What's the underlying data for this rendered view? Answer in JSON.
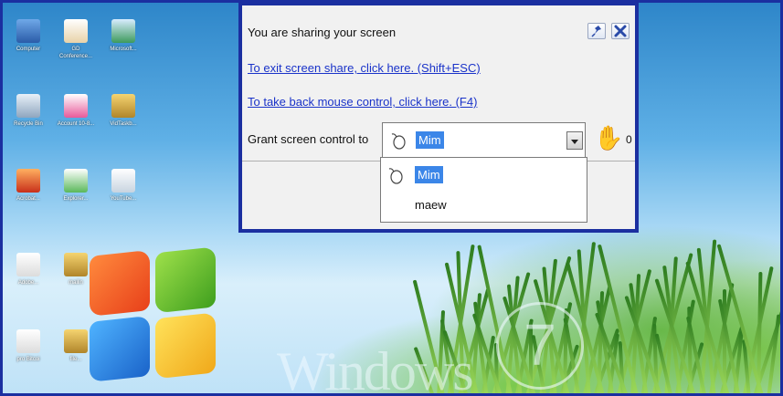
{
  "desktop": {
    "icons": [
      {
        "label": "Computer"
      },
      {
        "label": "GD Conference..."
      },
      {
        "label": "Microsoft..."
      },
      {
        "label": "Recycle Bin"
      },
      {
        "label": "Account 10-8..."
      },
      {
        "label": "VidTaskb..."
      },
      {
        "label": "Acrobat..."
      },
      {
        "label": "Explorer..."
      },
      {
        "label": "YouTube..."
      },
      {
        "label": "Adobe..."
      },
      {
        "label": "mailin"
      },
      {
        "label": "pro Bitcoi"
      },
      {
        "label": "file..."
      }
    ],
    "wallpaper_text": "Windows",
    "wallpaper_number": "7"
  },
  "share_panel": {
    "status": "You are sharing your screen",
    "exit_link": "To exit screen share, click here. (Shift+ESC)",
    "mouse_link": "To take back mouse control, click here. (F4)",
    "grant_label": "Grant screen control to",
    "selected_user": "Mim",
    "hand_count": "0",
    "pin_icon": "pin-icon",
    "close_icon": "close-icon"
  },
  "dropdown": {
    "options": [
      {
        "label": "Mim",
        "selected": true
      },
      {
        "label": "maew",
        "selected": false
      }
    ]
  },
  "colors": {
    "frame_border": "#1b2fa0",
    "link": "#1a33c9",
    "selection": "#3b86e8"
  }
}
